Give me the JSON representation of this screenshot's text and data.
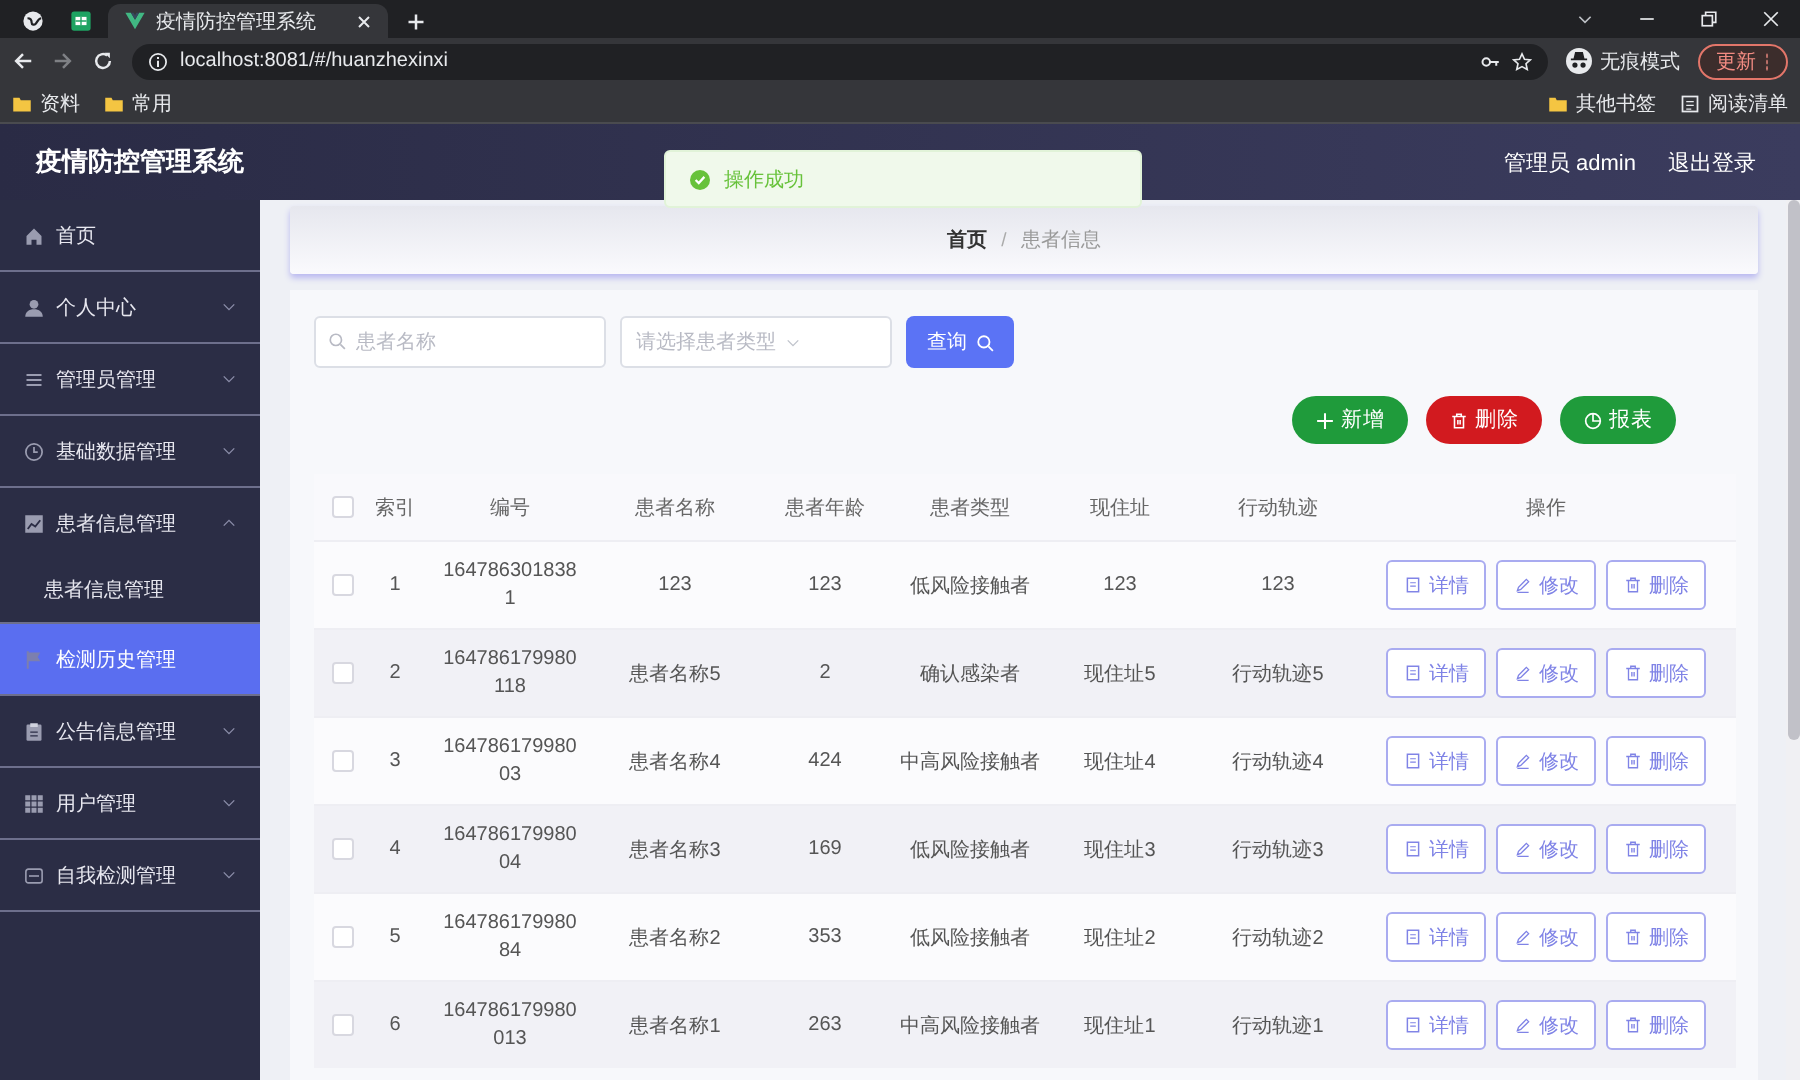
{
  "browser": {
    "tabs": [
      {
        "title": "疫情防控管理系统",
        "selected": true
      }
    ],
    "address": "localhost:8081/#/huanzhexinxi",
    "profile_label": "无痕模式",
    "update_button": "更新",
    "bookmarks": [
      "资料",
      "常用"
    ],
    "bookmarks_right": [
      "其他书签",
      "阅读清单"
    ]
  },
  "header": {
    "title": "疫情防控管理系统",
    "user": "管理员 admin",
    "logout": "退出登录"
  },
  "toast": {
    "message": "操作成功"
  },
  "sidebar": {
    "items": [
      {
        "label": "首页",
        "kind": "link",
        "selected": false
      },
      {
        "label": "个人中心",
        "kind": "menu",
        "expanded": false,
        "selected": false
      },
      {
        "label": "管理员管理",
        "kind": "menu",
        "expanded": false,
        "selected": false
      },
      {
        "label": "基础数据管理",
        "kind": "menu",
        "expanded": false,
        "selected": false
      },
      {
        "label": "患者信息管理",
        "kind": "menu",
        "expanded": true,
        "selected": false,
        "children": [
          {
            "label": "患者信息管理",
            "selected": false
          }
        ]
      },
      {
        "label": "检测历史管理",
        "kind": "link",
        "selected": true
      },
      {
        "label": "公告信息管理",
        "kind": "menu",
        "expanded": false,
        "selected": false
      },
      {
        "label": "用户管理",
        "kind": "menu",
        "expanded": false,
        "selected": false
      },
      {
        "label": "自我检测管理",
        "kind": "menu",
        "expanded": false,
        "selected": false
      }
    ]
  },
  "breadcrumb": {
    "items": [
      "首页",
      "患者信息"
    ],
    "separator": "/"
  },
  "search": {
    "name_placeholder": "患者名称",
    "type_placeholder": "请选择患者类型",
    "query_button": "查询"
  },
  "actions": [
    {
      "label": "新增",
      "kind": "add"
    },
    {
      "label": "删除",
      "kind": "delete"
    },
    {
      "label": "报表",
      "kind": "report"
    }
  ],
  "table": {
    "header_checked": false,
    "columns": [
      "索引",
      "编号",
      "患者名称",
      "患者年龄",
      "患者类型",
      "现住址",
      "行动轨迹",
      "操作"
    ],
    "rows": [
      {
        "checked": false,
        "cells": [
          "1",
          "1647863018381",
          "123",
          "123",
          "低风险接触者",
          "123",
          "123"
        ],
        "actions": [
          "详情",
          "修改",
          "删除"
        ]
      },
      {
        "checked": false,
        "cells": [
          "2",
          "164786179980118",
          "患者名称5",
          "2",
          "确认感染者",
          "现住址5",
          "行动轨迹5"
        ],
        "actions": [
          "详情",
          "修改",
          "删除"
        ]
      },
      {
        "checked": false,
        "cells": [
          "3",
          "16478617998003",
          "患者名称4",
          "424",
          "中高风险接触者",
          "现住址4",
          "行动轨迹4"
        ],
        "actions": [
          "详情",
          "修改",
          "删除"
        ]
      },
      {
        "checked": false,
        "cells": [
          "4",
          "16478617998004",
          "患者名称3",
          "169",
          "低风险接触者",
          "现住址3",
          "行动轨迹3"
        ],
        "actions": [
          "详情",
          "修改",
          "删除"
        ]
      },
      {
        "checked": false,
        "cells": [
          "5",
          "16478617998084",
          "患者名称2",
          "353",
          "低风险接触者",
          "现住址2",
          "行动轨迹2"
        ],
        "actions": [
          "详情",
          "修改",
          "删除"
        ]
      },
      {
        "checked": false,
        "cells": [
          "6",
          "164786179980013",
          "患者名称1",
          "263",
          "中高风险接触者",
          "现住址1",
          "行动轨迹1"
        ],
        "actions": [
          "详情",
          "修改",
          "删除"
        ]
      }
    ]
  }
}
